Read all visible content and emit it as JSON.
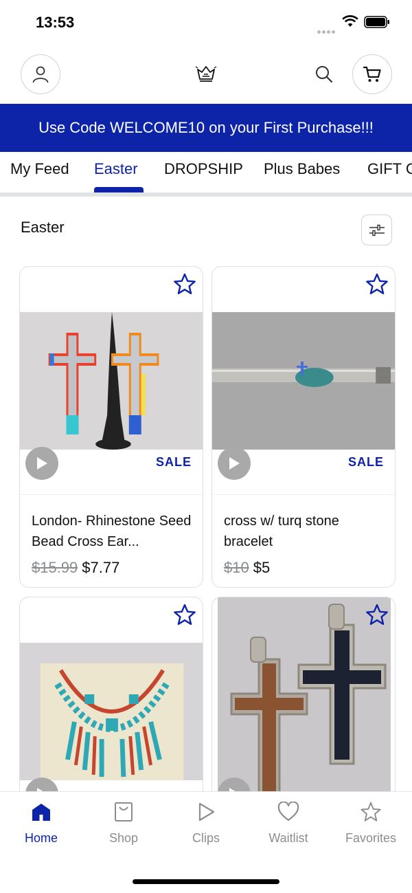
{
  "status_bar": {
    "time": "13:53"
  },
  "header": {
    "profile_icon": "person-icon",
    "logo_icon": "crown-logo-icon",
    "search_icon": "search-icon",
    "cart_icon": "cart-icon"
  },
  "promo": {
    "text": "Use Code WELCOME10 on your First Purchase!!!"
  },
  "tabs": [
    {
      "label": "My Feed"
    },
    {
      "label": "Easter"
    },
    {
      "label": "DROPSHIP"
    },
    {
      "label": "Plus Babes"
    },
    {
      "label": "GIFT C"
    }
  ],
  "active_tab": "Easter",
  "section": {
    "title": "Easter",
    "filter_icon": "sliders-icon"
  },
  "products": [
    {
      "title": "London- Rhinestone Seed Bead Cross Ear...",
      "old_price": "$15.99",
      "price": "$7.77",
      "badge": "SALE"
    },
    {
      "title": "cross w/ turq stone bracelet",
      "old_price": "$10",
      "price": "$5",
      "badge": "SALE"
    },
    {
      "title": "",
      "old_price": "",
      "price": "",
      "badge": ""
    },
    {
      "title": "",
      "old_price": "",
      "price": "",
      "badge": ""
    }
  ],
  "bottom_nav": [
    {
      "label": "Home",
      "icon": "home-icon",
      "active": true
    },
    {
      "label": "Shop",
      "icon": "shopping-bag-icon"
    },
    {
      "label": "Clips",
      "icon": "play-icon"
    },
    {
      "label": "Waitlist",
      "icon": "heart-icon"
    },
    {
      "label": "Favorites",
      "icon": "star-icon"
    }
  ],
  "colors": {
    "accent": "#0d24a8",
    "muted": "#8a8d91",
    "border": "#dcdfe3"
  }
}
